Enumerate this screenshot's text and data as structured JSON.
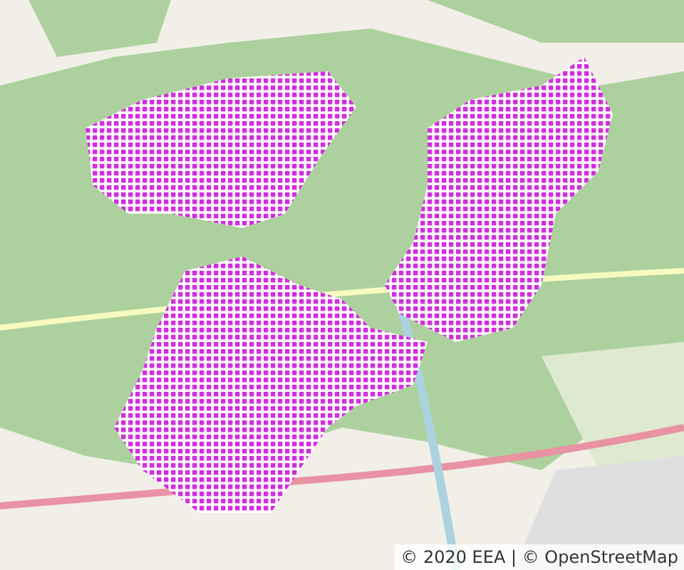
{
  "map": {
    "attribution": "© 2020 EEA | © OpenStreetMap"
  }
}
